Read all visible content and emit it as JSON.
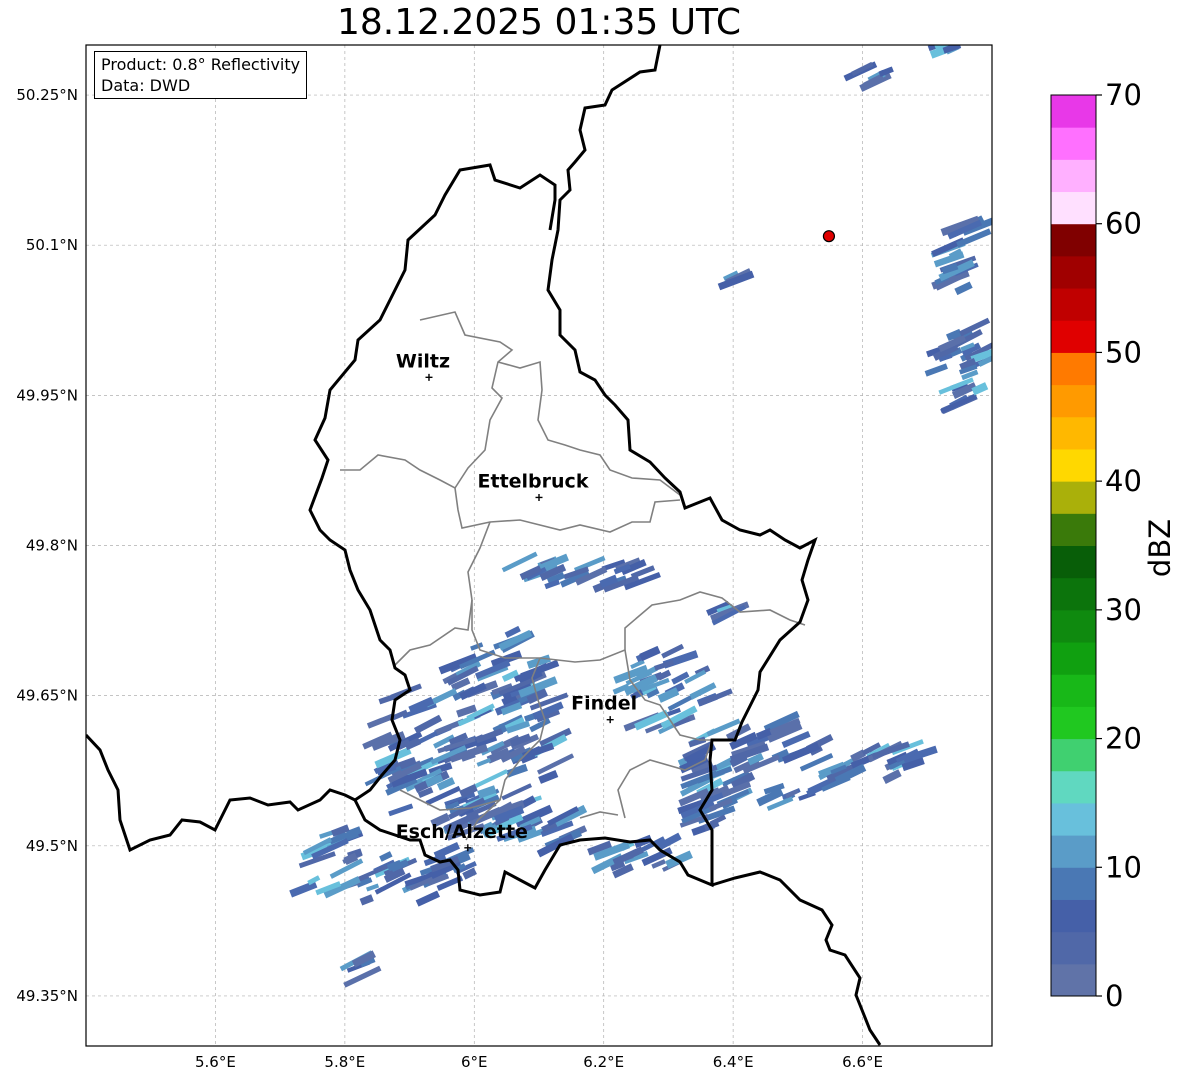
{
  "title": "18.12.2025 01:35 UTC",
  "info": {
    "product_line": "Product: 0.8° Reflectivity",
    "data_line": "Data: DWD"
  },
  "map": {
    "x_ticks": [
      "5.6°E",
      "5.8°E",
      "6°E",
      "6.2°E",
      "6.4°E",
      "6.6°E"
    ],
    "y_ticks": [
      "50.25°N",
      "50.1°N",
      "49.95°N",
      "49.8°N",
      "49.65°N",
      "49.5°N",
      "49.35°N"
    ],
    "x_tick_values": [
      5.6,
      5.8,
      6.0,
      6.2,
      6.4,
      6.6
    ],
    "y_tick_values": [
      50.25,
      50.1,
      49.95,
      49.8,
      49.65,
      49.5,
      49.35
    ],
    "lon_range": [
      5.4,
      6.8
    ],
    "lat_range": [
      49.3,
      50.3
    ],
    "grid": true,
    "cities": [
      {
        "name": "Wiltz",
        "lon": 5.93,
        "lat": 49.968
      },
      {
        "name": "Ettelbruck",
        "lon": 6.1,
        "lat": 49.848
      },
      {
        "name": "Findel",
        "lon": 6.21,
        "lat": 49.626
      },
      {
        "name": "Esch/Alzette",
        "lon": 5.99,
        "lat": 49.498
      }
    ],
    "radar_site": {
      "lon": 6.548,
      "lat": 50.109,
      "color": "#e00000"
    }
  },
  "colorbar": {
    "label": "dBZ",
    "ticks": [
      "0",
      "10",
      "20",
      "30",
      "40",
      "50",
      "60",
      "70"
    ],
    "range": [
      0,
      70
    ],
    "colors": [
      "#6073a8",
      "#5068a8",
      "#4560a8",
      "#4a78b4",
      "#5a9cc8",
      "#68c0dc",
      "#60d8c0",
      "#40d070",
      "#20c820",
      "#18b818",
      "#10a010",
      "#0f8a0f",
      "#0c740c",
      "#085e08",
      "#3a7a0a",
      "#aab00a",
      "#ffd800",
      "#ffb800",
      "#ff9a00",
      "#ff7a00",
      "#e00000",
      "#c00000",
      "#a00000",
      "#800000",
      "#ffe0ff",
      "#ffb0ff",
      "#ff70ff",
      "#e838e8"
    ]
  }
}
